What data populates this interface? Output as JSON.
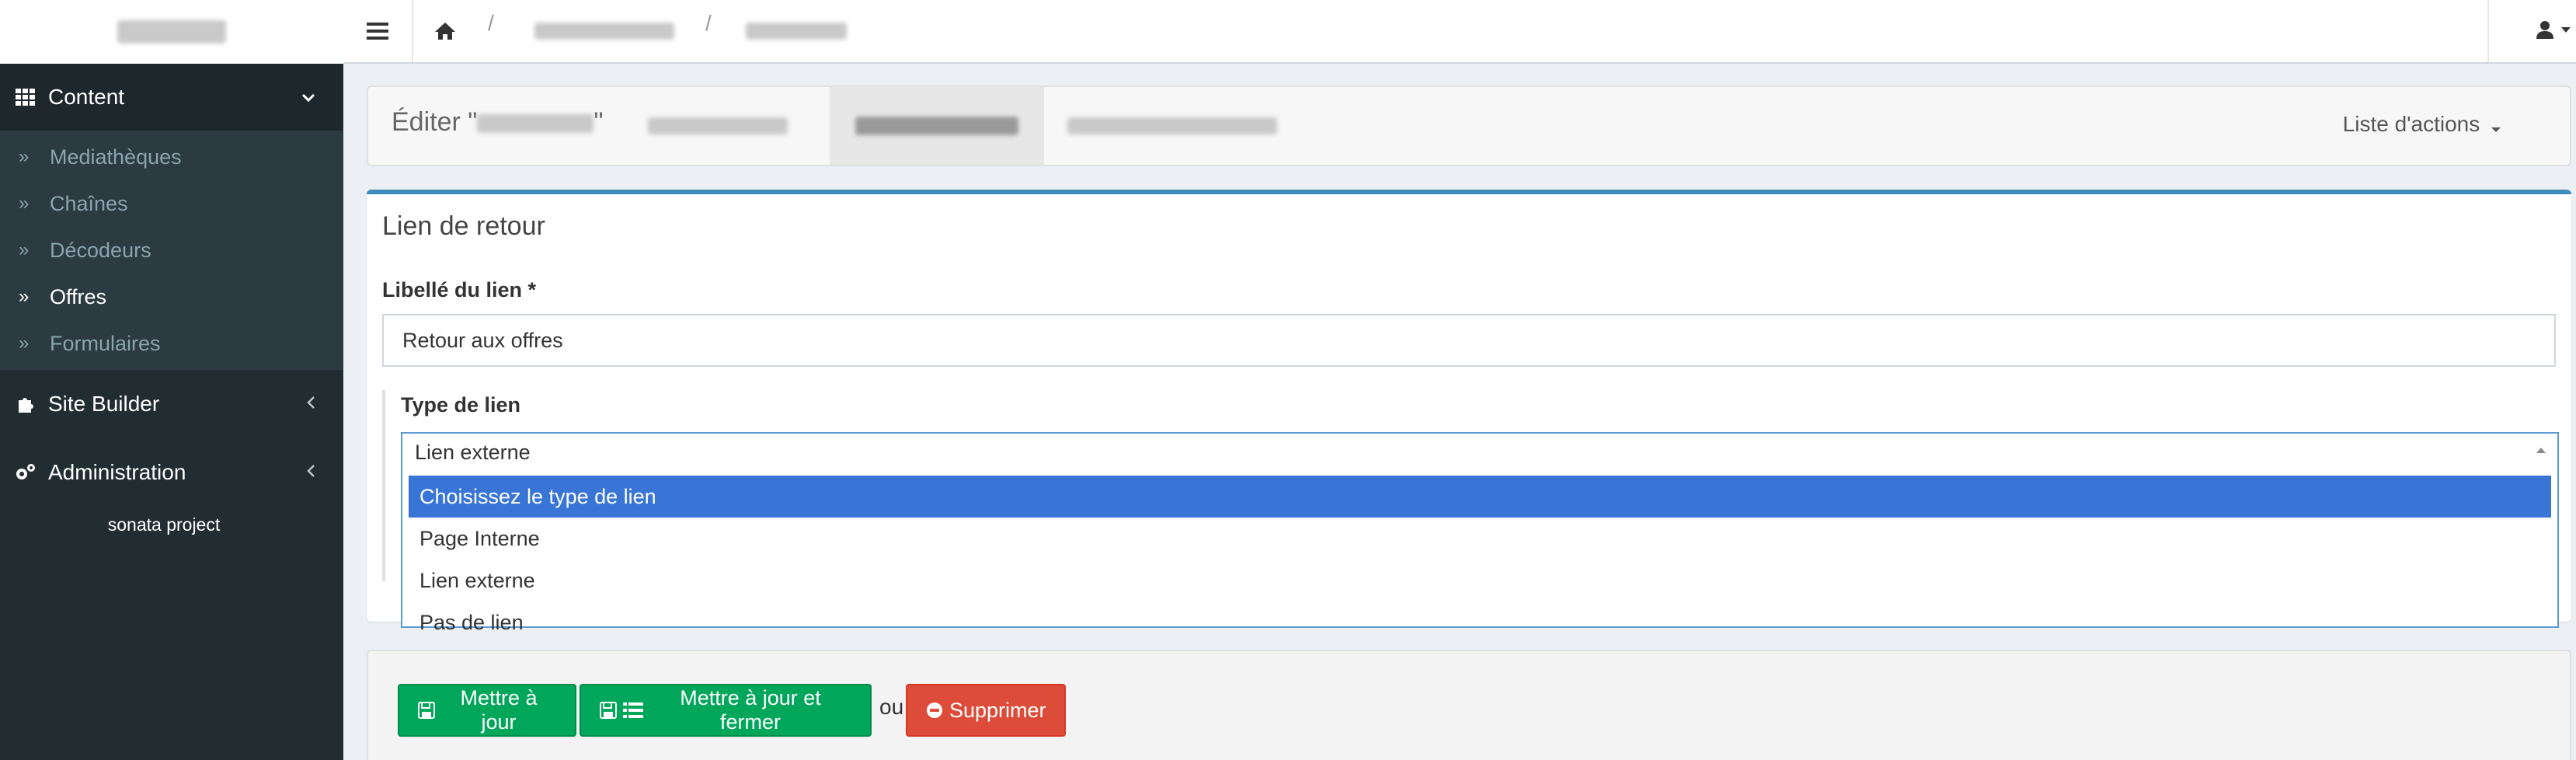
{
  "sidebar": {
    "sections": [
      {
        "label": "Content",
        "icon": "grid-icon",
        "expanded": true,
        "items": [
          {
            "label": "Mediathèques"
          },
          {
            "label": "Chaînes"
          },
          {
            "label": "Décodeurs"
          },
          {
            "label": "Offres",
            "current": true
          },
          {
            "label": "Formulaires"
          }
        ]
      },
      {
        "label": "Site Builder",
        "icon": "puzzle-icon",
        "expanded": false
      },
      {
        "label": "Administration",
        "icon": "cogs-icon",
        "expanded": false
      }
    ],
    "footer": "sonata project"
  },
  "header": {
    "edit_prefix": "Éditer \"",
    "edit_suffix": "\"",
    "actions_label": "Liste d'actions"
  },
  "form": {
    "box_title": "Lien de retour",
    "link_label": {
      "label": "Libellé du lien *",
      "value": "Retour aux offres"
    },
    "link_type": {
      "label": "Type de lien",
      "selected": "Lien externe",
      "options": [
        "Choisissez le type de lien",
        "Page Interne",
        "Lien externe",
        "Pas de lien"
      ],
      "highlighted_index": 0
    }
  },
  "footer_actions": {
    "update": "Mettre à jour",
    "update_close": "Mettre à jour et fermer",
    "or": "ou",
    "delete": "Supprimer"
  },
  "colors": {
    "sidebar_bg": "#222d32",
    "accent_blue": "#3c8dbc",
    "highlight": "#3875d7",
    "success": "#00a65a",
    "danger": "#dd4b39"
  }
}
